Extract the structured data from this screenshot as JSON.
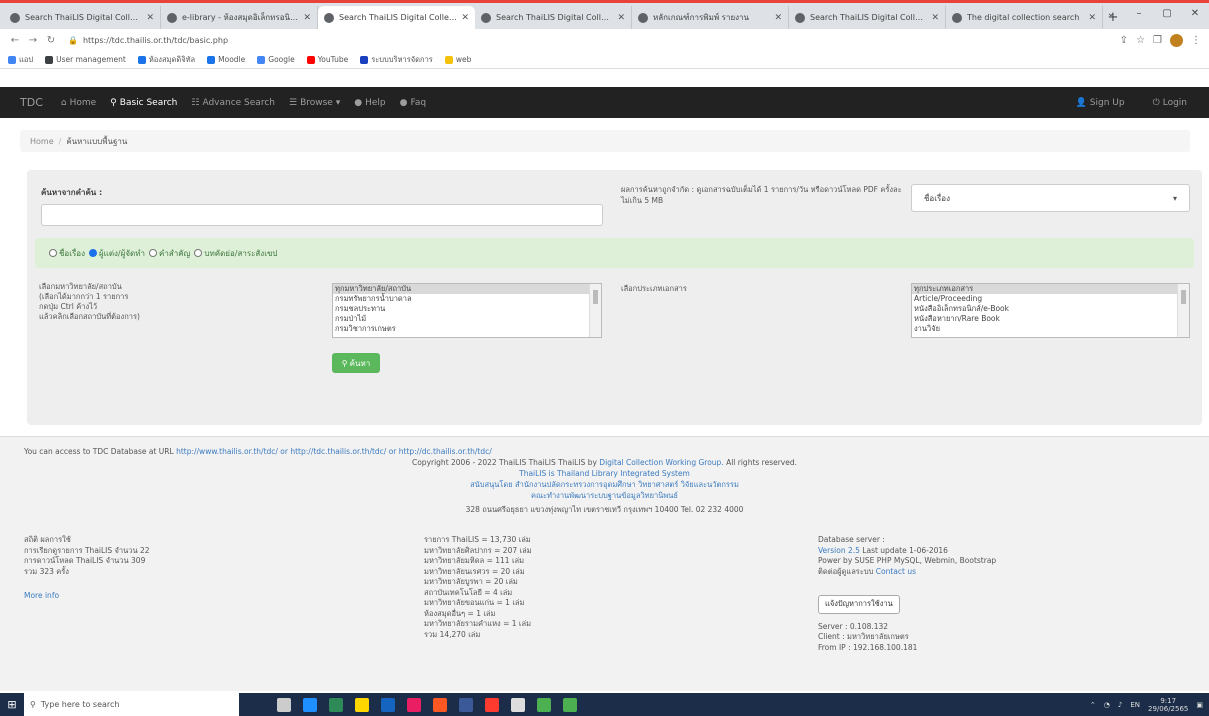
{
  "browser": {
    "tabs": [
      {
        "title": "Search ThaiLIS Digital Collecti",
        "active": false
      },
      {
        "title": "e-library - ห้องสมุดอิเล็กทรอนิกส์",
        "active": false
      },
      {
        "title": "Search ThaiLIS Digital Collecti",
        "active": true
      },
      {
        "title": "Search ThaiLIS Digital Collecti",
        "active": false
      },
      {
        "title": "หลักเกณฑ์การพิมพ์ รายงาน",
        "active": false
      },
      {
        "title": "Search ThaiLIS Digital Collecti",
        "active": false
      },
      {
        "title": "The digital collection search",
        "active": false
      }
    ],
    "new_tab": "+",
    "window_controls": [
      "⌄",
      "–",
      "▢",
      "✕"
    ],
    "url": "https://tdc.thailis.or.th/tdc/basic.php",
    "bookmarks": [
      {
        "label": "แอป",
        "color": "#4285f4"
      },
      {
        "label": "User management",
        "color": "#3c4043"
      },
      {
        "label": "ห้องสมุดดิจิทัล",
        "color": "#1a73e8"
      },
      {
        "label": "Moodle",
        "color": "#1a73e8"
      },
      {
        "label": "Google",
        "color": "#4285f4"
      },
      {
        "label": "YouTube",
        "color": "#ff0000"
      },
      {
        "label": "ระบบบริหารจัดการ",
        "color": "#1a3fbf"
      },
      {
        "label": "web",
        "color": "#f4c20d"
      }
    ]
  },
  "site": {
    "brand": "TDC",
    "nav": [
      {
        "label": "Home",
        "icon": "⌂",
        "active": false
      },
      {
        "label": "Basic Search",
        "icon": "⚲",
        "active": true
      },
      {
        "label": "Advance Search",
        "icon": "☷",
        "active": false
      },
      {
        "label": "Browse ▾",
        "icon": "☰",
        "active": false
      },
      {
        "label": "Help",
        "icon": "●",
        "active": false
      },
      {
        "label": "Faq",
        "icon": "●",
        "active": false
      }
    ],
    "nav_right": [
      {
        "label": "Sign Up",
        "icon": "👤"
      },
      {
        "label": "Login",
        "icon": "⏻"
      }
    ]
  },
  "breadcrumb": {
    "home": "Home",
    "current": "ค้นหาแบบพื้นฐาน"
  },
  "search": {
    "keyword_label": "ค้นหาจากคำค้น :",
    "keyword_value": "",
    "limit_note": "ผลการค้นหาถูกจำกัด : ดูเอกสารฉบับเต็มได้ 1 รายการ/วัน หรือดาวน์โหลด PDF ครั้งละไม่เกิน 5 MB",
    "field_select": "ชื่อเรื่อง",
    "radios": [
      {
        "label": "ชื่อเรื่อง",
        "checked": false
      },
      {
        "label": "ผู้แต่ง/ผู้จัดทำ",
        "checked": true
      },
      {
        "label": "คำสำคัญ",
        "checked": false
      },
      {
        "label": "บทคัดย่อ/สาระสังเขป",
        "checked": false
      }
    ],
    "institution_note": [
      "เลือกมหาวิทยาลัย/สถาบัน",
      "(เลือกได้มากกว่า 1 รายการ",
      "กดปุ่ม Ctrl ค้างไว้",
      "แล้วคลิกเลือกสถาบันที่ต้องการ)"
    ],
    "institutions": [
      "ทุกมหาวิทยาลัย/สถาบัน",
      "กรมทรัพยากรน้ำบาดาล",
      "กรมชลประทาน",
      "กรมป่าไม้",
      "กรมวิชาการเกษตร"
    ],
    "type_label": "เลือกประเภทเอกสาร",
    "types": [
      "ทุกประเภทเอกสาร",
      "Article/Proceeding",
      "หนังสืออิเล็กทรอนิกส์/e-Book",
      "หนังสือหายาก/Rare Book",
      "งานวิจัย"
    ],
    "button_label": "ค้นหา",
    "button_icon": "⚲"
  },
  "footer": {
    "access_text": "You can access to TDC Database at URL",
    "access_urls": "http://www.thailis.or.th/tdc/ or http://tdc.thailis.or.th/tdc/ or http://dc.thailis.or.th/tdc/",
    "copyright_prefix": "Copyright 2006 - 2022 ThaiLIS ThaiLIS ThaiLIS by",
    "copyright_link": "Digital Collection Working Group.",
    "copyright_suffix": "All rights reserved.",
    "system_line": "ThaiLIS is Thailand Library Integrated System",
    "org_line_1": "สนับสนุนโดย สำนักงานปลัดกระทรวงการอุดมศึกษา วิทยาศาสตร์ วิจัยและนวัตกรรม",
    "org_line_2": "คณะทำงานพัฒนาระบบฐานข้อมูลวิทยานิพนธ์",
    "address_line": "328 ถนนศรีอยุธยา แขวงทุ่งพญาไท เขตราชเทวี กรุงเทพฯ 10400 Tel. 02 232 4000",
    "left_stats": [
      "สถิติ ผลการใช้",
      "การเรียกดูรายการ ThaiLIS จำนวน 22",
      "การดาวน์โหลด ThaiLIS จำนวน 309",
      "รวม 323 ครั้ง"
    ],
    "more_info": "More info",
    "stats": [
      "รายการ ThaiLIS = 13,730 เล่ม",
      "มหาวิทยาลัยศิลปากร = 207 เล่ม",
      "มหาวิทยาลัยมหิดล = 111 เล่ม",
      "มหาวิทยาลัยนเรศวร = 20 เล่ม",
      "มหาวิทยาลัยบูรพา = 20 เล่ม",
      "สถาบันเทคโนโลยี = 4 เล่ม",
      "มหาวิทยาลัยขอนแก่น = 1 เล่ม",
      "ห้องสมุดอื่นๆ = 1 เล่ม",
      "มหาวิทยาลัยรามคำแหง = 1 เล่ม",
      "รวม 14,270 เล่ม"
    ],
    "db_label": "Database server :",
    "db_version_link": "Version 2.5",
    "db_version_rest": "Last update 1-06-2016",
    "db_powered": "Power by SUSE PHP MySQL, Webmin, Bootstrap",
    "db_contact_prefix": "ติดต่อผู้ดูแลระบบ",
    "db_contact_link": "Contact us",
    "db_button": "แจ้งปัญหาการใช้งาน",
    "server": "Server : 0.108.132",
    "client": "Client : มหาวิทยาลัยเกษตร",
    "from_ip": "From IP : 192.168.100.181"
  },
  "taskbar": {
    "search_placeholder": "Type here to search",
    "icon_colors": [
      "#ccc",
      "#1e90ff",
      "#2e8b57",
      "#ffd700",
      "#1565c0",
      "#e91e63",
      "#ff5722",
      "#3b5998",
      "#ff3b30",
      "#ddd",
      "#4caf50",
      "#4caf50"
    ],
    "tray_lang": "EN",
    "time": "9:17",
    "date": "29/06/2565"
  }
}
